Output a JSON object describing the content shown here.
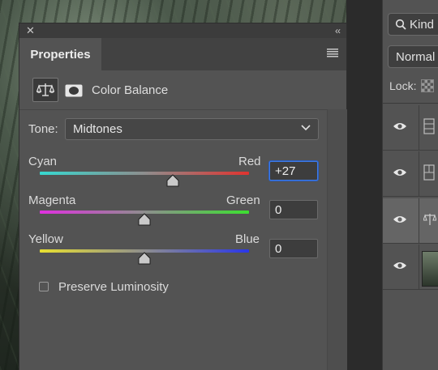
{
  "layers_panel": {
    "kind_label": "Kind",
    "blend_mode": "Normal",
    "lock_label": "Lock:"
  },
  "properties": {
    "tab_title": "Properties",
    "adjustment_title": "Color Balance",
    "tone_label": "Tone:",
    "tone_value": "Midtones",
    "sliders": [
      {
        "left_label": "Cyan",
        "right_label": "Red",
        "value": "+27",
        "numeric": 27
      },
      {
        "left_label": "Magenta",
        "right_label": "Green",
        "value": "0",
        "numeric": 0
      },
      {
        "left_label": "Yellow",
        "right_label": "Blue",
        "value": "0",
        "numeric": 0
      }
    ],
    "preserve_luminosity_label": "Preserve Luminosity",
    "preserve_luminosity_checked": false
  },
  "icons": {
    "close": "close-icon",
    "collapse": "collapse-icon",
    "panel_menu": "hamburger-menu-icon",
    "adjustment": "balance-scale-icon",
    "mask": "mask-icon",
    "dropdown": "chevron-down-icon",
    "search": "search-icon",
    "visibility": "eye-icon"
  },
  "colors": {
    "panel_bg": "#535353",
    "focus_border": "#3f7be8"
  }
}
